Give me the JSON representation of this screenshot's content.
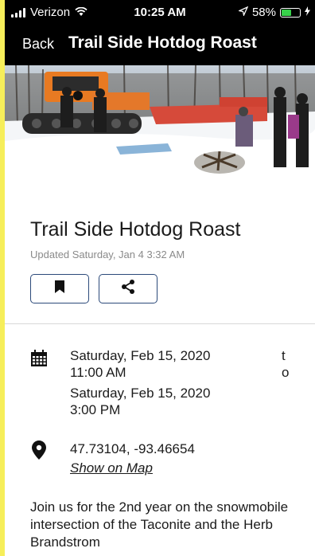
{
  "status_bar": {
    "carrier": "Verizon",
    "time": "10:25 AM",
    "battery_percent": "58%",
    "battery_level": 0.58,
    "battery_color": "#38d04a"
  },
  "nav": {
    "back_label": "Back",
    "title": "Trail Side Hotdog Roast"
  },
  "event": {
    "title": "Trail Side Hotdog Roast",
    "updated": "Updated Saturday, Jan 4 3:32 AM",
    "start_date": "Saturday, Feb 15, 2020",
    "start_time": "11:00 AM",
    "separator": "to",
    "end_date": "Saturday, Feb 15, 2020",
    "end_time": "3:00 PM",
    "coordinates": "47.73104, -93.46654",
    "map_link": "Show on Map",
    "description": "Join us for the 2nd year on the snowmobile intersection of the Taconite and the Herb Brandstrom"
  },
  "icons": {
    "bookmark": "bookmark-icon",
    "share": "share-icon",
    "calendar": "calendar-icon",
    "location": "location-pin-icon"
  },
  "colors": {
    "button_border": "#2c4a7a",
    "side_accent": "#f6ee5a"
  }
}
